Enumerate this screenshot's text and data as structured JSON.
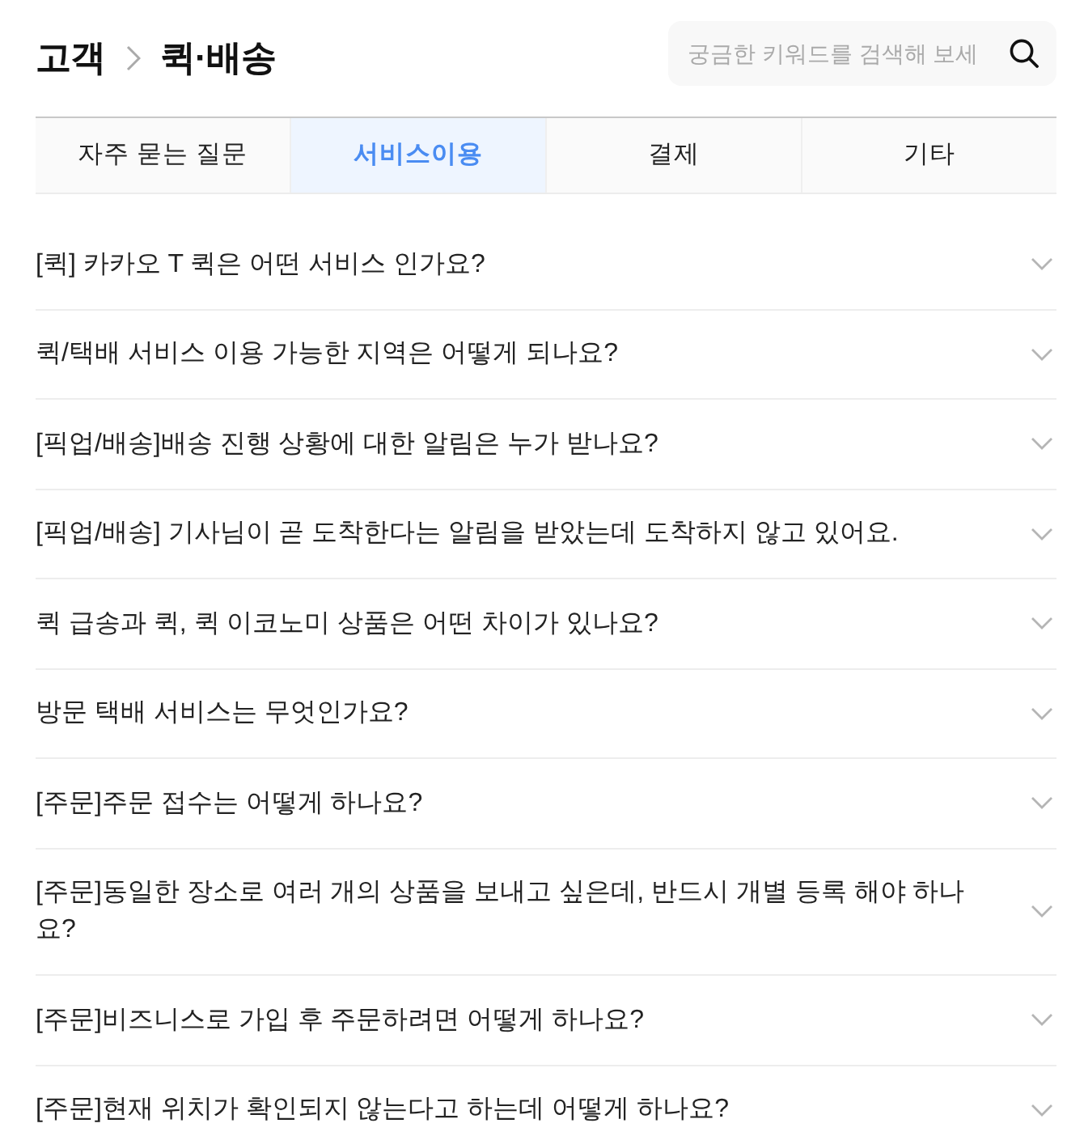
{
  "header": {
    "breadcrumb": [
      {
        "label": "고객"
      },
      {
        "label": "퀵·배송"
      }
    ]
  },
  "search": {
    "placeholder": "궁금한 키워드를 검색해 보세"
  },
  "tabs": [
    {
      "label": "자주 묻는 질문",
      "selected": false
    },
    {
      "label": "서비스이용",
      "selected": true
    },
    {
      "label": "결제",
      "selected": false
    },
    {
      "label": "기타",
      "selected": false
    }
  ],
  "faq": [
    {
      "question": "[퀵] 카카오 T 퀵은 어떤 서비스 인가요?",
      "expanded": false
    },
    {
      "question": "퀵/택배 서비스 이용 가능한 지역은 어떻게 되나요?",
      "expanded": false
    },
    {
      "question": "[픽업/배송]배송 진행 상황에 대한 알림은 누가 받나요?",
      "expanded": false
    },
    {
      "question": "[픽업/배송] 기사님이 곧 도착한다는 알림을 받았는데 도착하지 않고 있어요.",
      "expanded": false
    },
    {
      "question": "퀵 급송과 퀵, 퀵 이코노미 상품은 어떤 차이가 있나요?",
      "expanded": false
    },
    {
      "question": "방문 택배 서비스는 무엇인가요?",
      "expanded": false
    },
    {
      "question": "[주문]주문 접수는 어떻게 하나요?",
      "expanded": false
    },
    {
      "question": "[주문]동일한 장소로 여러 개의 상품을 보내고 싶은데, 반드시 개별 등록 해야 하나요?",
      "expanded": false
    },
    {
      "question": "[주문]비즈니스로 가입 후 주문하려면 어떻게 하나요?",
      "expanded": false
    },
    {
      "question": "[주문]현재 위치가 확인되지 않는다고 하는데 어떻게 하나요?",
      "expanded": false
    }
  ]
}
